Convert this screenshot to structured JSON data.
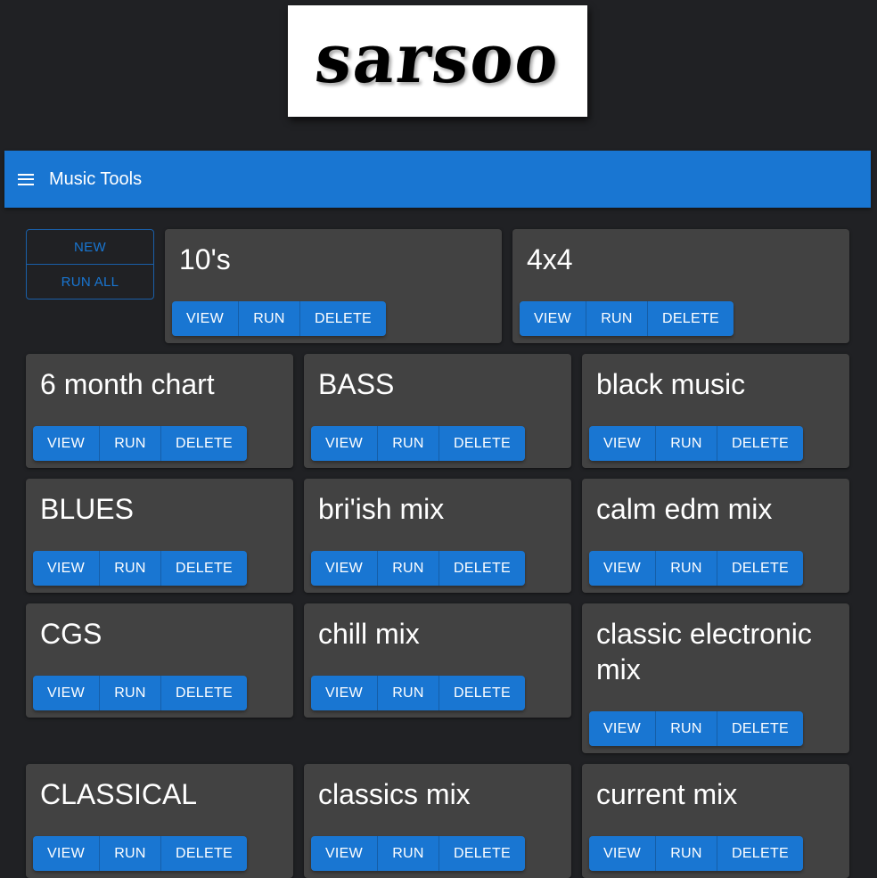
{
  "logo": {
    "text": "sarsoo"
  },
  "appbar": {
    "title": "Music Tools",
    "menu_icon": "hamburger-menu-icon"
  },
  "actions": {
    "new_label": "NEW",
    "run_all_label": "RUN ALL"
  },
  "card_buttons": {
    "view": "VIEW",
    "run": "RUN",
    "delete": "DELETE"
  },
  "playlists": [
    {
      "name": "10's"
    },
    {
      "name": "4x4"
    },
    {
      "name": "6 month chart"
    },
    {
      "name": "BASS"
    },
    {
      "name": "black music"
    },
    {
      "name": "BLUES"
    },
    {
      "name": "bri'ish mix"
    },
    {
      "name": "calm edm mix"
    },
    {
      "name": "CGS"
    },
    {
      "name": "chill mix"
    },
    {
      "name": "classic electronic mix"
    },
    {
      "name": "CLASSICAL"
    },
    {
      "name": "classics mix"
    },
    {
      "name": "current mix"
    }
  ],
  "colors": {
    "primary": "#1976d2",
    "background": "#202124",
    "card": "#424242"
  }
}
